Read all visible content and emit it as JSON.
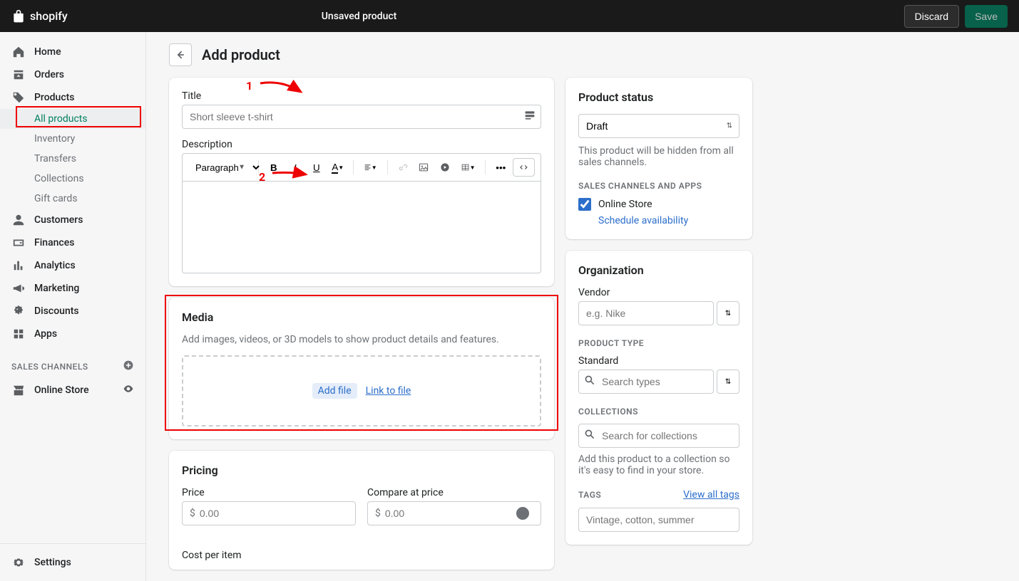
{
  "topbar": {
    "brand": "shopify",
    "title": "Unsaved product",
    "discard": "Discard",
    "save": "Save"
  },
  "nav": {
    "home": "Home",
    "orders": "Orders",
    "products": "Products",
    "all_products": "All products",
    "inventory": "Inventory",
    "transfers": "Transfers",
    "collections": "Collections",
    "gift_cards": "Gift cards",
    "customers": "Customers",
    "finances": "Finances",
    "analytics": "Analytics",
    "marketing": "Marketing",
    "discounts": "Discounts",
    "apps": "Apps",
    "sales_channels_label": "SALES CHANNELS",
    "online_store": "Online Store",
    "settings": "Settings"
  },
  "page": {
    "heading": "Add product"
  },
  "form": {
    "title_label": "Title",
    "title_placeholder": "Short sleeve t-shirt",
    "description_label": "Description",
    "paragraph": "Paragraph"
  },
  "media": {
    "heading": "Media",
    "desc": "Add images, videos, or 3D models to show product details and features.",
    "add_file": "Add file",
    "link_to_file": "Link to file"
  },
  "pricing": {
    "heading": "Pricing",
    "price_label": "Price",
    "compare_label": "Compare at price",
    "placeholder": "0.00",
    "currency": "$",
    "cost_label": "Cost per item"
  },
  "status": {
    "heading": "Product status",
    "value": "Draft",
    "hint": "This product will be hidden from all sales channels.",
    "channels_label": "SALES CHANNELS AND APPS",
    "online_store": "Online Store",
    "schedule": "Schedule availability"
  },
  "org": {
    "heading": "Organization",
    "vendor_label": "Vendor",
    "vendor_placeholder": "e.g. Nike",
    "type_label": "PRODUCT TYPE",
    "standard": "Standard",
    "search_types": "Search types",
    "collections_label": "COLLECTIONS",
    "collections_placeholder": "Search for collections",
    "collections_hint": "Add this product to a collection so it's easy to find in your store.",
    "tags_label": "TAGS",
    "view_all_tags": "View all tags",
    "tags_placeholder": "Vintage, cotton, summer"
  },
  "annotations": {
    "one": "1",
    "two": "2"
  }
}
